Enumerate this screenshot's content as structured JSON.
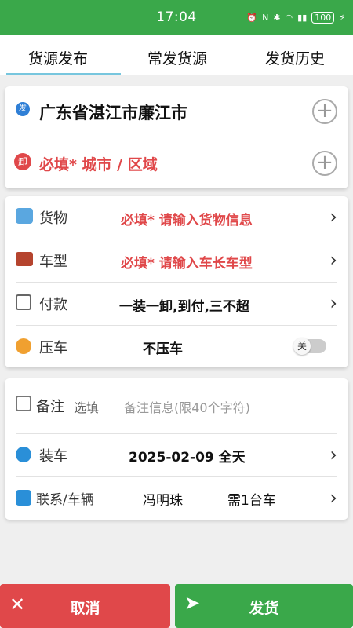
{
  "status": {
    "time": "17:04",
    "battery": "100"
  },
  "tabs": [
    {
      "label": "货源发布"
    },
    {
      "label": "常发货源"
    },
    {
      "label": "发货历史"
    }
  ],
  "route": {
    "origin": "广东省湛江市廉江市",
    "origin_badge": "发",
    "dest_badge": "卸",
    "dest_placeholder": "必填* 城市 / 区域"
  },
  "details": {
    "cargo": {
      "label": "货物",
      "value": "必填* 请输入货物信息"
    },
    "vehicle": {
      "label": "车型",
      "value": "必填* 请输入车长车型"
    },
    "payment": {
      "label": "付款",
      "value": "一装一卸,到付,三不超"
    },
    "pressure": {
      "label": "压车",
      "value": "不压车",
      "toggle": "关"
    }
  },
  "extra": {
    "remark": {
      "label": "备注",
      "hint": "选填",
      "placeholder": "备注信息(限40个字符)"
    },
    "loading": {
      "label": "装车",
      "value": "2025-02-09 全天"
    },
    "contact": {
      "label": "联系/车辆",
      "name": "冯明珠",
      "count": "需1台车"
    }
  },
  "actions": {
    "cancel": "取消",
    "submit": "发货"
  },
  "colors": {
    "green": "#3aa84a",
    "red": "#e0484a",
    "required_red": "#e0484a"
  }
}
